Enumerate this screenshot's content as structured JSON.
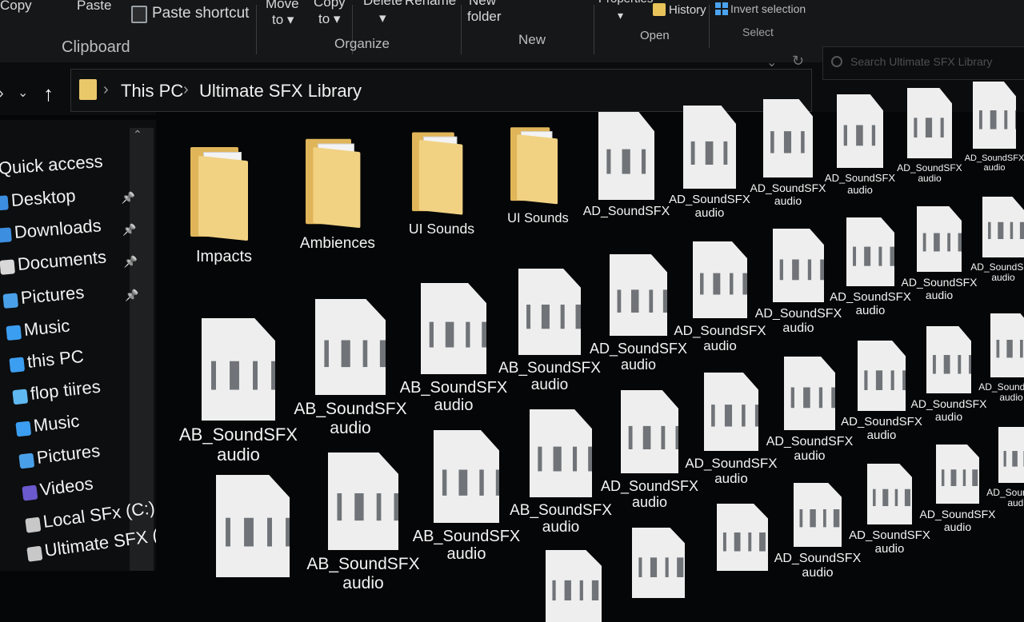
{
  "ribbon": {
    "copy_left": "Copy",
    "paste": "Paste",
    "paste_shortcut": "Paste shortcut",
    "clipboard_group": "Clipboard",
    "move_to": [
      "Move",
      "to ▾"
    ],
    "copy_to": [
      "Copy",
      "to ▾"
    ],
    "delete": "Delete",
    "rename": "Rename",
    "organize_group": "Organize",
    "new_folder": [
      "New",
      "folder"
    ],
    "new_group": "New",
    "properties": "Properties",
    "history": "History",
    "open_group": "Open",
    "invert_selection": "Invert selection",
    "select_group": "Select"
  },
  "address": {
    "crumbs": [
      "This PC",
      "Ultimate SFX Library"
    ],
    "search_placeholder": "Search Ultimate SFX Library"
  },
  "sidebar": {
    "items": [
      {
        "label": "Quick access",
        "icon": "star-icon"
      },
      {
        "label": "Desktop",
        "icon": "desktop-icon",
        "pinned": true
      },
      {
        "label": "Downloads",
        "icon": "download-icon",
        "pinned": true
      },
      {
        "label": "Documents",
        "icon": "document-icon",
        "pinned": true
      },
      {
        "label": "Pictures",
        "icon": "pictures-icon",
        "pinned": true
      },
      {
        "label": "Music",
        "icon": "music-icon"
      },
      {
        "label": "this PC",
        "icon": "pc-icon"
      },
      {
        "label": "flop tiires",
        "icon": "cube-icon"
      },
      {
        "label": "Music",
        "icon": "music-icon"
      },
      {
        "label": "Pictures",
        "icon": "pictures-icon"
      },
      {
        "label": "Videos",
        "icon": "videos-icon"
      },
      {
        "label": "Local SFx (C:)",
        "icon": "drive-icon"
      },
      {
        "label": "Ultimate SFX (C:)",
        "icon": "drive-icon"
      }
    ]
  },
  "folders": [
    "Impacts",
    "Ambiences",
    "UI Sounds",
    "UI Sounds"
  ],
  "files": {
    "name_ab": "AB_SoundSFX",
    "name_ad": "AD_SoundSFX",
    "type": "audio"
  },
  "colors": {
    "folder": "#e9c86a",
    "background": "#050607",
    "file": "#eeeeee"
  }
}
